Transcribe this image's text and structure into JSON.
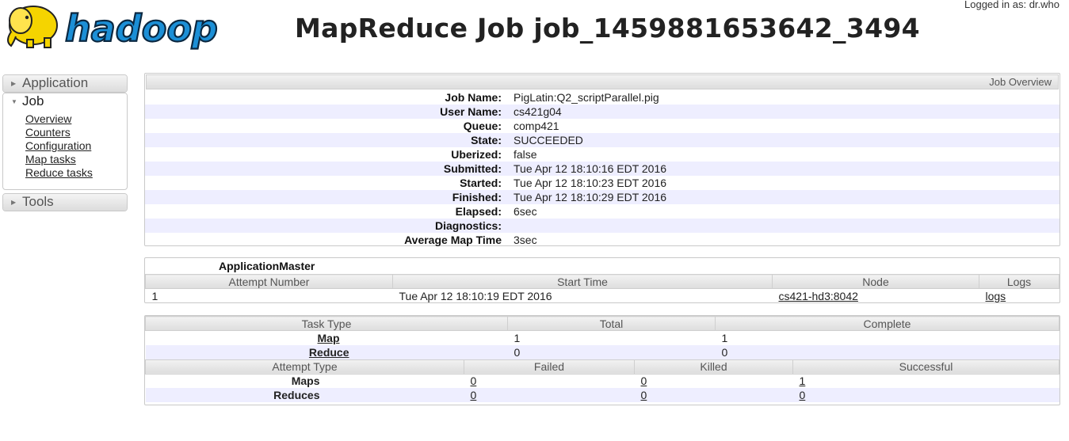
{
  "header": {
    "logo_text": "hadoop",
    "title": "MapReduce Job job_1459881653642_3494",
    "logged_in": "Logged in as: dr.who"
  },
  "sidebar": {
    "application": "Application",
    "job": "Job",
    "job_links": [
      "Overview",
      "Counters",
      "Configuration",
      "Map tasks",
      "Reduce tasks"
    ],
    "tools": "Tools"
  },
  "overview": {
    "header": "Job Overview",
    "rows": [
      {
        "key": "Job Name:",
        "value": "PigLatin:Q2_scriptParallel.pig"
      },
      {
        "key": "User Name:",
        "value": "cs421g04"
      },
      {
        "key": "Queue:",
        "value": "comp421"
      },
      {
        "key": "State:",
        "value": "SUCCEEDED"
      },
      {
        "key": "Uberized:",
        "value": "false"
      },
      {
        "key": "Submitted:",
        "value": "Tue Apr 12 18:10:16 EDT 2016"
      },
      {
        "key": "Started:",
        "value": "Tue Apr 12 18:10:23 EDT 2016"
      },
      {
        "key": "Finished:",
        "value": "Tue Apr 12 18:10:29 EDT 2016"
      },
      {
        "key": "Elapsed:",
        "value": "6sec"
      },
      {
        "key": "Diagnostics:",
        "value": ""
      },
      {
        "key": "Average Map Time",
        "value": "3sec"
      }
    ]
  },
  "app_master": {
    "title": "ApplicationMaster",
    "headers": [
      "Attempt Number",
      "Start Time",
      "Node",
      "Logs"
    ],
    "row": {
      "attempt": "1",
      "start_time": "Tue Apr 12 18:10:19 EDT 2016",
      "node": "cs421-hd3:8042",
      "logs": "logs"
    }
  },
  "tasks": {
    "headers": [
      "Task Type",
      "Total",
      "Complete"
    ],
    "rows": [
      {
        "type": "Map",
        "total": "1",
        "complete": "1"
      },
      {
        "type": "Reduce",
        "total": "0",
        "complete": "0"
      }
    ],
    "attempt_headers": [
      "Attempt Type",
      "Failed",
      "Killed",
      "Successful"
    ],
    "attempt_rows": [
      {
        "type": "Maps",
        "failed": "0",
        "killed": "0",
        "successful": "1"
      },
      {
        "type": "Reduces",
        "failed": "0",
        "killed": "0",
        "successful": "0"
      }
    ]
  }
}
